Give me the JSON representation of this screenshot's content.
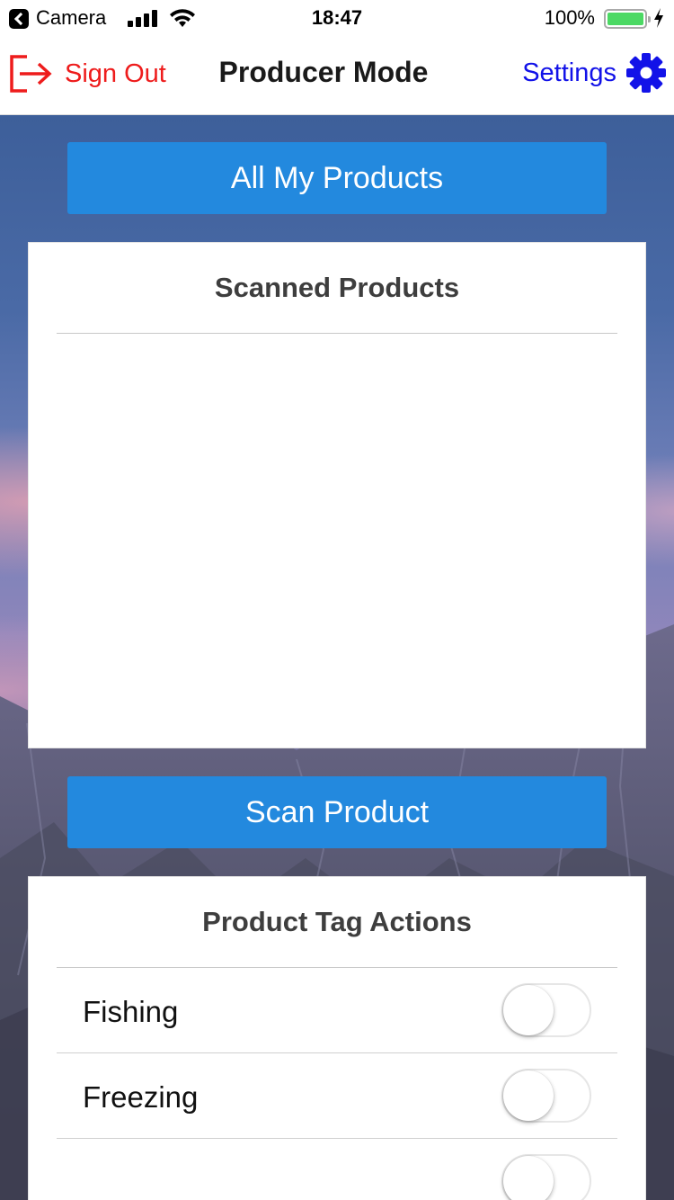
{
  "status_bar": {
    "back_app": "Camera",
    "time": "18:47",
    "battery": "100%"
  },
  "nav": {
    "sign_out": "Sign Out",
    "title": "Producer Mode",
    "settings": "Settings"
  },
  "all_products_button": "All My Products",
  "scanned_card": {
    "title": "Scanned Products"
  },
  "scan_button": "Scan Product",
  "tag_card": {
    "title": "Product Tag Actions",
    "items": [
      {
        "label": "Fishing",
        "on": false
      },
      {
        "label": "Freezing",
        "on": false
      },
      {
        "label": "",
        "on": false
      }
    ]
  },
  "colors": {
    "primary_button": "#2389de",
    "sign_out": "#ee1c1c",
    "settings": "#1212e8",
    "battery": "#4cd964"
  },
  "icons": {
    "sign_out": "sign-out-icon",
    "settings": "gear-icon"
  }
}
